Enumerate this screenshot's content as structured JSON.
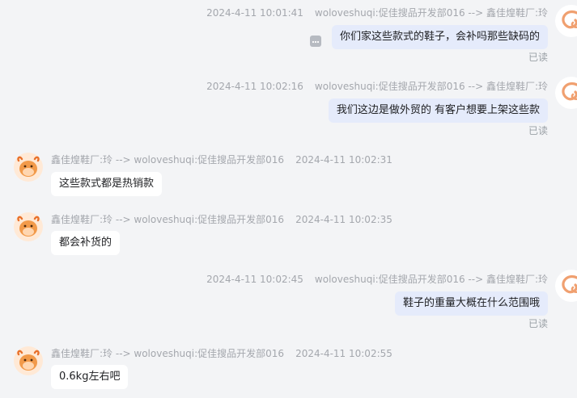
{
  "messages": [
    {
      "time": "2024-4-11 10:01:41",
      "route": "woloveshuqi:促佳搜品开发部016 --> 鑫佳煌鞋厂:玲",
      "text": "你们家这些款式的鞋子，会补吗那些缺码的",
      "status": "已读"
    },
    {
      "time": "2024-4-11 10:02:16",
      "route": "woloveshuqi:促佳搜品开发部016 --> 鑫佳煌鞋厂:玲",
      "text": "我们这边是做外贸的  有客户想要上架这些款",
      "status": "已读"
    },
    {
      "route": "鑫佳煌鞋厂:玲 --> woloveshuqi:促佳搜品开发部016",
      "time": "2024-4-11 10:02:31",
      "text": "这些款式都是热销款"
    },
    {
      "route": "鑫佳煌鞋厂:玲 --> woloveshuqi:促佳搜品开发部016",
      "time": "2024-4-11 10:02:35",
      "text": "都会补货的"
    },
    {
      "time": "2024-4-11 10:02:45",
      "route": "woloveshuqi:促佳搜品开发部016 --> 鑫佳煌鞋厂:玲",
      "text": "鞋子的重量大概在什么范围哦",
      "status": "已读"
    },
    {
      "route": "鑫佳煌鞋厂:玲 --> woloveshuqi:促佳搜品开发部016",
      "time": "2024-4-11 10:02:55",
      "text": "0.6kg左右吧"
    }
  ],
  "icons": {
    "outgoing_avatar": "c-logo-avatar",
    "incoming_avatar": "cow-avatar",
    "message_action": "more-options-icon"
  },
  "colors": {
    "background": "#f3f4f6",
    "outgoing_bubble": "#e5ebfb",
    "incoming_bubble": "#ffffff",
    "meta_text": "#a4a7ad",
    "logo_orange": "#f0a070"
  }
}
